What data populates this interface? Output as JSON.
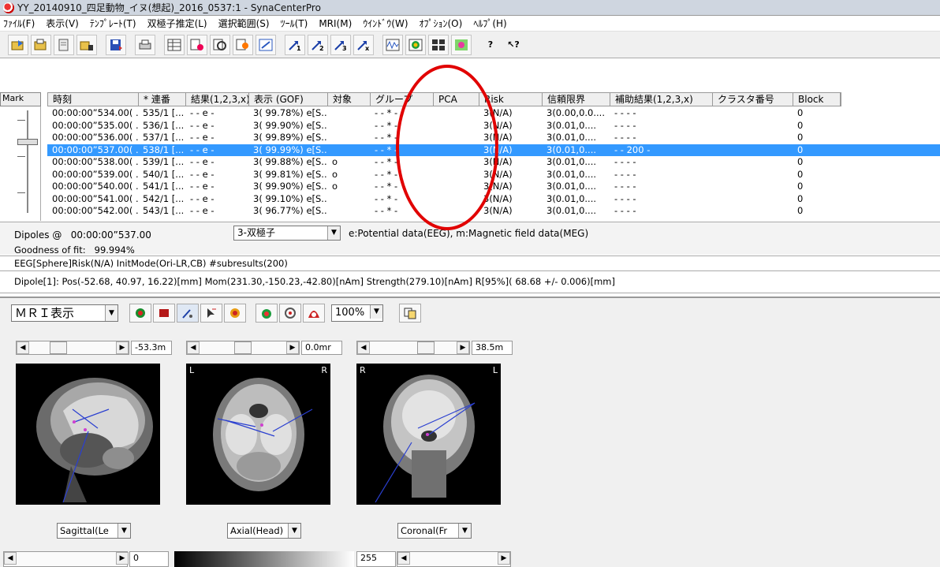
{
  "window": {
    "title": "YY_20140910_四足動物_イヌ(想起)_2016_0537:1 - SynaCenterPro"
  },
  "menu": [
    "ﾌｧｲﾙ(F)",
    "表示(V)",
    "ﾃﾝﾌﾟﾚｰﾄ(T)",
    "双極子推定(L)",
    "選択範囲(S)",
    "ﾂｰﾙ(T)",
    "MRI(M)",
    "ｳｲﾝﾄﾞｳ(W)",
    "ｵﾌﾟｼｮﾝ(O)",
    "ﾍﾙﾌﾟ(H)"
  ],
  "table": {
    "mark_label": "Mark",
    "columns": [
      "時刻",
      "* 連番",
      "結果(1,2,3,x)",
      "表示 (GOF)",
      "対象",
      "グループ",
      "PCA",
      "Risk",
      "信頼限界",
      "補助結果(1,2,3,x)",
      "クラスタ番号",
      "Block"
    ],
    "rows": [
      [
        "00:00:00”534.00( ...",
        "535/1  [...",
        "- - e -",
        "3( 99.78%) e[S...",
        "",
        "- - * -",
        "",
        "3(N/A)",
        "3(0.00,0.0....",
        "- - - -",
        "",
        "0"
      ],
      [
        "00:00:00”535.00( ...",
        "536/1  [...",
        "- - e -",
        "3( 99.90%) e[S...",
        "",
        "- - * -",
        "",
        "3(N/A)",
        "3(0.01,0....",
        "- - - -",
        "",
        "0"
      ],
      [
        "00:00:00”536.00( ...",
        "537/1  [...",
        "- - e -",
        "3( 99.89%) e[S...",
        "",
        "- - * -",
        "",
        "3(N/A)",
        "3(0.01,0....",
        "- - - -",
        "",
        "0"
      ],
      [
        "00:00:00”537.00( ...",
        "538/1  [...",
        "- - e -",
        "3( 99.99%) e[S...",
        "",
        "- - * -",
        "",
        "3(N/A)",
        "3(0.01,0....",
        "- - 200 -",
        "",
        "0"
      ],
      [
        "00:00:00”538.00( ...",
        "539/1  [...",
        "- - e -",
        "3( 99.88%) e[S...",
        "o",
        "- - * -",
        "",
        "3(N/A)",
        "3(0.01,0....",
        "- - - -",
        "",
        "0"
      ],
      [
        "00:00:00”539.00( ...",
        "540/1  [...",
        "- - e -",
        "3( 99.81%) e[S...",
        "o",
        "- - * -",
        "",
        "3(N/A)",
        "3(0.01,0....",
        "- - - -",
        "",
        "0"
      ],
      [
        "00:00:00”540.00( ...",
        "541/1  [...",
        "- - e -",
        "3( 99.90%) e[S...",
        "o",
        "- - * -",
        "",
        "3(N/A)",
        "3(0.01,0....",
        "- - - -",
        "",
        "0"
      ],
      [
        "00:00:00”541.00( ...",
        "542/1  [...",
        "- - e -",
        "3( 99.10%) e[S...",
        "",
        "- - * -",
        "",
        "3(N/A)",
        "3(0.01,0....",
        "- - - -",
        "",
        "0"
      ],
      [
        "00:00:00”542.00( ...",
        "543/1  [...",
        "- - e -",
        "3( 96.77%) e[S...",
        "",
        "- - * -",
        "",
        "3(N/A)",
        "3(0.01,0....",
        "- - - -",
        "",
        "0"
      ]
    ],
    "selected_row": 3
  },
  "info": {
    "dipoles_label": "Dipoles @",
    "dipoles_time": "00:00:00”537.00",
    "gof_label": "Goodness of fit:",
    "gof_value": "99.994%",
    "dipole_type": "3-双極子",
    "legend": "e:Potential data(EEG), m:Magnetic field data(MEG)",
    "eeg_line": "EEG[Sphere]Risk(N/A) InitMode(Ori-LR,CB) #subresults(200)",
    "dipole_line1": "Dipole[1]: Pos(-52.68, 40.97, 16.22)[mm]  Mom(231.30,-150.23,-42.80)[nAm]  Strength(279.10)[nAm]  R[95%]( 68.68 +/- 0.006)[mm]"
  },
  "mri": {
    "mode": "ＭＲＩ表示",
    "zoom": "100%",
    "views": [
      {
        "slider_value": "-53.3m",
        "plane": "Sagittal(Le",
        "left": "",
        "right": ""
      },
      {
        "slider_value": "0.0mr",
        "plane": "Axial(Head)",
        "left": "L",
        "right": "R"
      },
      {
        "slider_value": "38.5m",
        "plane": "Coronal(Fr",
        "left": "R",
        "right": "L"
      }
    ],
    "window_min": "0",
    "window_max": "255"
  },
  "colors": {
    "selection": "#3399ff",
    "annotation": "#e10000"
  }
}
